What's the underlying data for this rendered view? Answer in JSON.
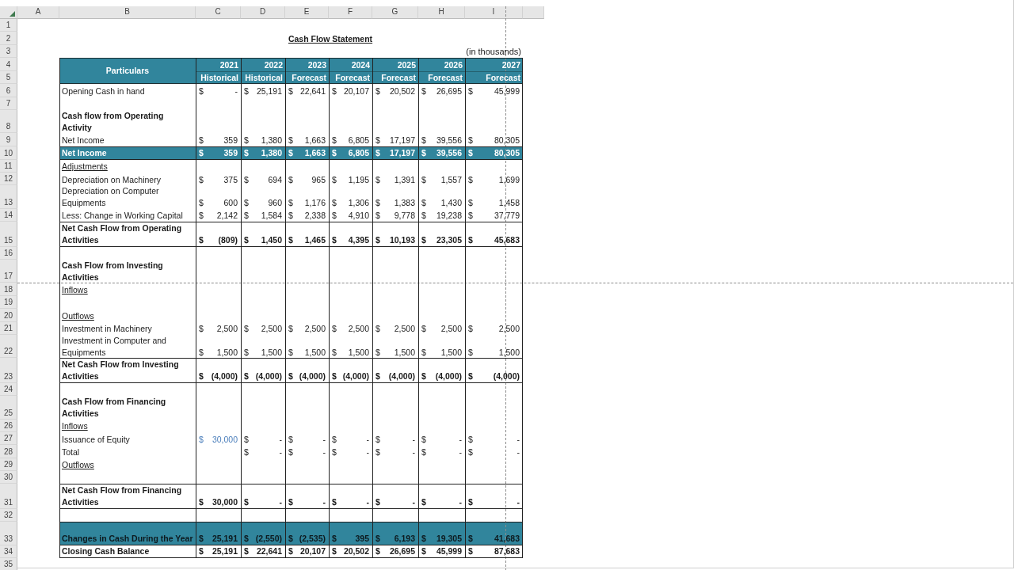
{
  "sheet": {
    "columns": [
      "A",
      "B",
      "C",
      "D",
      "E",
      "F",
      "G",
      "H",
      "I"
    ],
    "row_numbers": [
      "1",
      "2",
      "3",
      "4",
      "5",
      "6",
      "7",
      "8",
      "9",
      "10",
      "11",
      "12",
      "13",
      "14",
      "15",
      "16",
      "17",
      "18",
      "19",
      "20",
      "21",
      "22",
      "23",
      "24",
      "25",
      "26",
      "27",
      "28",
      "29",
      "30",
      "31",
      "32",
      "33",
      "34",
      "35"
    ]
  },
  "title": "Cash Flow Statement",
  "unit_note": "(in thousands)",
  "table": {
    "header": {
      "label": "Particulars",
      "years": [
        {
          "year": "2021",
          "basis": "Historical"
        },
        {
          "year": "2022",
          "basis": "Historical"
        },
        {
          "year": "2023",
          "basis": "Forecast"
        },
        {
          "year": "2024",
          "basis": "Forecast"
        },
        {
          "year": "2025",
          "basis": "Forecast"
        },
        {
          "year": "2026",
          "basis": "Forecast"
        },
        {
          "year": "2027",
          "basis": "Forecast"
        }
      ]
    },
    "rows": [
      {
        "kind": "item",
        "label": "Opening Cash in hand",
        "cells": [
          {
            "currency": "$",
            "amount": "-"
          },
          {
            "currency": "$",
            "amount": "25,191"
          },
          {
            "currency": "$",
            "amount": "22,641"
          },
          {
            "currency": "$",
            "amount": "20,107"
          },
          {
            "currency": "$",
            "amount": "20,502"
          },
          {
            "currency": "$",
            "amount": "26,695"
          },
          {
            "currency": "$",
            "amount": "45,999"
          }
        ]
      },
      {
        "kind": "blank"
      },
      {
        "kind": "section",
        "label": "Cash flow from Operating Activity"
      },
      {
        "kind": "item",
        "label": "Net Income",
        "cells": [
          {
            "currency": "$",
            "amount": "359"
          },
          {
            "currency": "$",
            "amount": "1,380"
          },
          {
            "currency": "$",
            "amount": "1,663"
          },
          {
            "currency": "$",
            "amount": "6,805"
          },
          {
            "currency": "$",
            "amount": "17,197"
          },
          {
            "currency": "$",
            "amount": "39,556"
          },
          {
            "currency": "$",
            "amount": "80,305"
          }
        ]
      },
      {
        "kind": "highlight",
        "label": "Net Income",
        "cells": [
          {
            "currency": "$",
            "amount": "359"
          },
          {
            "currency": "$",
            "amount": "1,380"
          },
          {
            "currency": "$",
            "amount": "1,663"
          },
          {
            "currency": "$",
            "amount": "6,805"
          },
          {
            "currency": "$",
            "amount": "17,197"
          },
          {
            "currency": "$",
            "amount": "39,556"
          },
          {
            "currency": "$",
            "amount": "80,305"
          }
        ]
      },
      {
        "kind": "subheading",
        "label": "Adjustments"
      },
      {
        "kind": "item",
        "label": "Depreciation on Machinery",
        "cells": [
          {
            "currency": "$",
            "amount": "375"
          },
          {
            "currency": "$",
            "amount": "694"
          },
          {
            "currency": "$",
            "amount": "965"
          },
          {
            "currency": "$",
            "amount": "1,195"
          },
          {
            "currency": "$",
            "amount": "1,391"
          },
          {
            "currency": "$",
            "amount": "1,557"
          },
          {
            "currency": "$",
            "amount": "1,699"
          }
        ]
      },
      {
        "kind": "item",
        "label": "Depreciation on Computer Equipments",
        "cells": [
          {
            "currency": "$",
            "amount": "600"
          },
          {
            "currency": "$",
            "amount": "960"
          },
          {
            "currency": "$",
            "amount": "1,176"
          },
          {
            "currency": "$",
            "amount": "1,306"
          },
          {
            "currency": "$",
            "amount": "1,383"
          },
          {
            "currency": "$",
            "amount": "1,430"
          },
          {
            "currency": "$",
            "amount": "1,458"
          }
        ]
      },
      {
        "kind": "item",
        "label": "Less: Change in Working Capital",
        "cells": [
          {
            "currency": "$",
            "amount": "2,142"
          },
          {
            "currency": "$",
            "amount": "1,584"
          },
          {
            "currency": "$",
            "amount": "2,338"
          },
          {
            "currency": "$",
            "amount": "4,910"
          },
          {
            "currency": "$",
            "amount": "9,778"
          },
          {
            "currency": "$",
            "amount": "19,238"
          },
          {
            "currency": "$",
            "amount": "37,779"
          }
        ]
      },
      {
        "kind": "subtotal",
        "label": "Net Cash Flow from Operating Activities",
        "cells": [
          {
            "currency": "$",
            "amount": "(809)"
          },
          {
            "currency": "$",
            "amount": "1,450"
          },
          {
            "currency": "$",
            "amount": "1,465"
          },
          {
            "currency": "$",
            "amount": "4,395"
          },
          {
            "currency": "$",
            "amount": "10,193"
          },
          {
            "currency": "$",
            "amount": "23,305"
          },
          {
            "currency": "$",
            "amount": "45,683"
          }
        ]
      },
      {
        "kind": "blank"
      },
      {
        "kind": "section",
        "label": "Cash Flow from Investing Activities"
      },
      {
        "kind": "subheading",
        "label": "Inflows"
      },
      {
        "kind": "blank"
      },
      {
        "kind": "subheading",
        "label": "Outflows"
      },
      {
        "kind": "item",
        "label": "Investment in Machinery",
        "cells": [
          {
            "currency": "$",
            "amount": "2,500"
          },
          {
            "currency": "$",
            "amount": "2,500"
          },
          {
            "currency": "$",
            "amount": "2,500"
          },
          {
            "currency": "$",
            "amount": "2,500"
          },
          {
            "currency": "$",
            "amount": "2,500"
          },
          {
            "currency": "$",
            "amount": "2,500"
          },
          {
            "currency": "$",
            "amount": "2,500"
          }
        ]
      },
      {
        "kind": "item",
        "label": "Investment in Computer and Equipments",
        "cells": [
          {
            "currency": "$",
            "amount": "1,500"
          },
          {
            "currency": "$",
            "amount": "1,500"
          },
          {
            "currency": "$",
            "amount": "1,500"
          },
          {
            "currency": "$",
            "amount": "1,500"
          },
          {
            "currency": "$",
            "amount": "1,500"
          },
          {
            "currency": "$",
            "amount": "1,500"
          },
          {
            "currency": "$",
            "amount": "1,500"
          }
        ]
      },
      {
        "kind": "subtotal",
        "label": "Net Cash Flow from Investing Activities",
        "cells": [
          {
            "currency": "$",
            "amount": "(4,000)"
          },
          {
            "currency": "$",
            "amount": "(4,000)"
          },
          {
            "currency": "$",
            "amount": "(4,000)"
          },
          {
            "currency": "$",
            "amount": "(4,000)"
          },
          {
            "currency": "$",
            "amount": "(4,000)"
          },
          {
            "currency": "$",
            "amount": "(4,000)"
          },
          {
            "currency": "$",
            "amount": "(4,000)"
          }
        ]
      },
      {
        "kind": "blank"
      },
      {
        "kind": "section",
        "label": "Cash Flow from Financing Activities"
      },
      {
        "kind": "subheading",
        "label": "Inflows"
      },
      {
        "kind": "item",
        "label": "Issuance of Equity",
        "cells": [
          {
            "currency": "$",
            "amount": "30,000",
            "color": "#4a7ebb"
          },
          {
            "currency": "$",
            "amount": "-"
          },
          {
            "currency": "$",
            "amount": "-"
          },
          {
            "currency": "$",
            "amount": "-"
          },
          {
            "currency": "$",
            "amount": "-"
          },
          {
            "currency": "$",
            "amount": "-"
          },
          {
            "currency": "$",
            "amount": "-"
          }
        ]
      },
      {
        "kind": "item",
        "label": "Total",
        "cells": [
          null,
          {
            "currency": "$",
            "amount": "-"
          },
          {
            "currency": "$",
            "amount": "-"
          },
          {
            "currency": "$",
            "amount": "-"
          },
          {
            "currency": "$",
            "amount": "-"
          },
          {
            "currency": "$",
            "amount": "-"
          },
          {
            "currency": "$",
            "amount": "-"
          }
        ]
      },
      {
        "kind": "subheading",
        "label": "Outflows"
      },
      {
        "kind": "blank"
      },
      {
        "kind": "subtotal",
        "label": "Net Cash Flow from Financing Activities",
        "cells": [
          {
            "currency": "$",
            "amount": "30,000"
          },
          {
            "currency": "$",
            "amount": "-"
          },
          {
            "currency": "$",
            "amount": "-"
          },
          {
            "currency": "$",
            "amount": "-"
          },
          {
            "currency": "$",
            "amount": "-"
          },
          {
            "currency": "$",
            "amount": "-"
          },
          {
            "currency": "$",
            "amount": "-"
          }
        ]
      },
      {
        "kind": "blank"
      },
      {
        "kind": "band",
        "label": "Changes in Cash During the Year",
        "cells": [
          {
            "currency": "$",
            "amount": "25,191"
          },
          {
            "currency": "$",
            "amount": "(2,550)"
          },
          {
            "currency": "$",
            "amount": "(2,535)"
          },
          {
            "currency": "$",
            "amount": "395"
          },
          {
            "currency": "$",
            "amount": "6,193"
          },
          {
            "currency": "$",
            "amount": "19,305"
          },
          {
            "currency": "$",
            "amount": "41,683"
          }
        ]
      },
      {
        "kind": "total",
        "label": "Closing Cash Balance",
        "cells": [
          {
            "currency": "$",
            "amount": "25,191"
          },
          {
            "currency": "$",
            "amount": "22,641"
          },
          {
            "currency": "$",
            "amount": "20,107"
          },
          {
            "currency": "$",
            "amount": "20,502"
          },
          {
            "currency": "$",
            "amount": "26,695"
          },
          {
            "currency": "$",
            "amount": "45,999"
          },
          {
            "currency": "$",
            "amount": "87,683"
          }
        ]
      }
    ]
  }
}
